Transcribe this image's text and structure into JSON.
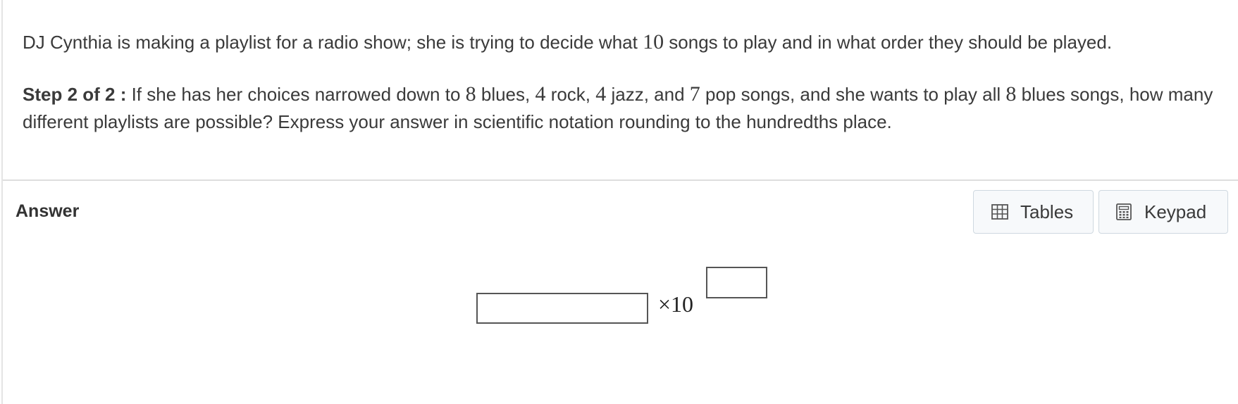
{
  "question": {
    "intro": {
      "before": "DJ Cynthia is making a playlist for a radio show; she is trying to decide what ",
      "n_songs": "10",
      "after": " songs to play and in what order they should be played."
    },
    "step": {
      "label": "Step 2 of 2 :",
      "t1": "  If she has her choices narrowed down to ",
      "blues": "8",
      "t2": " blues, ",
      "rock": "4",
      "t3": " rock, ",
      "jazz": "4",
      "t4": " jazz, and ",
      "pop": "7",
      "t5": " pop songs, and she wants to play all ",
      "blues_all": "8",
      "t6": " blues songs, how many different playlists are possible? Express your answer in scientific notation rounding to the hundredths place."
    }
  },
  "answer": {
    "label": "Answer",
    "times_ten": "×10",
    "mantissa_value": "",
    "exponent_value": ""
  },
  "tools": {
    "tables_label": "Tables",
    "tables_icon": "table-icon",
    "keypad_label": "Keypad",
    "keypad_icon": "calculator-icon"
  }
}
